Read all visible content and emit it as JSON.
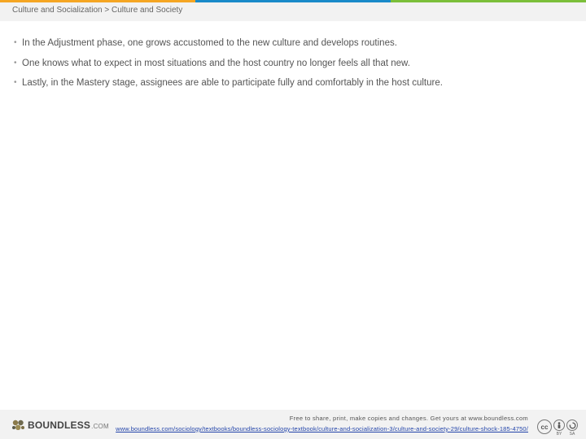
{
  "theme": {
    "stripe_colors": [
      "#f5a623",
      "#1a8ac9",
      "#7bbf3a"
    ],
    "header_bg": "#f2f2f2",
    "link_color": "#2244aa"
  },
  "header": {
    "breadcrumb": "Culture and Socialization > Culture and Society"
  },
  "content": {
    "bullets": [
      "In the Adjustment phase, one grows accustomed to the new culture and develops routines.",
      "One knows what to expect in most situations and the host country no longer feels all that new.",
      "Lastly, in the Mastery stage, assignees are able to participate fully and comfortably in the host culture."
    ]
  },
  "footer": {
    "logo_text": "BOUNDLESS",
    "logo_suffix": ".COM",
    "logo_icon": "boundless-hexagon-icon",
    "note": "Free to share, print, make copies and changes. Get yours at www.boundless.com",
    "url": "www.boundless.com/sociology/textbooks/boundless-sociology-textbook/culture-and-socialization-3/culture-and-society-29/culture-shock-185-4750/",
    "license": {
      "cc": "cc",
      "by": "BY",
      "sa": "SA",
      "icons": [
        "cc-icon",
        "attribution-icon",
        "share-alike-icon"
      ]
    }
  }
}
